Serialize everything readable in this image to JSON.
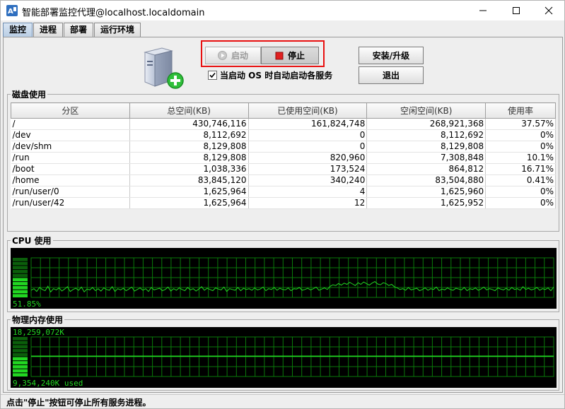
{
  "window": {
    "title": "智能部署监控代理@localhost.localdomain"
  },
  "tabs": [
    {
      "label": "监控",
      "active": true
    },
    {
      "label": "进程",
      "active": false
    },
    {
      "label": "部署",
      "active": false
    },
    {
      "label": "运行环境",
      "active": false
    }
  ],
  "controls": {
    "start_label": "启动",
    "start_enabled": false,
    "stop_label": "停止",
    "install_label": "安装/升级",
    "exit_label": "退出",
    "autostart_label": "当启动 OS 时自动启动各服务",
    "autostart_checked": true,
    "highlight_color": "#e81010"
  },
  "disk": {
    "title": "磁盘使用",
    "columns": [
      "分区",
      "总空间(KB)",
      "已使用空间(KB)",
      "空闲空间(KB)",
      "使用率"
    ],
    "rows": [
      [
        "/",
        "430,746,116",
        "161,824,748",
        "268,921,368",
        "37.57%"
      ],
      [
        "/dev",
        "8,112,692",
        "0",
        "8,112,692",
        "0%"
      ],
      [
        "/dev/shm",
        "8,129,808",
        "0",
        "8,129,808",
        "0%"
      ],
      [
        "/run",
        "8,129,808",
        "820,960",
        "7,308,848",
        "10.1%"
      ],
      [
        "/boot",
        "1,038,336",
        "173,524",
        "864,812",
        "16.71%"
      ],
      [
        "/home",
        "83,845,120",
        "340,240",
        "83,504,880",
        "0.41%"
      ],
      [
        "/run/user/0",
        "1,625,964",
        "4",
        "1,625,960",
        "0%"
      ],
      [
        "/run/user/42",
        "1,625,964",
        "12",
        "1,625,952",
        "0%"
      ]
    ]
  },
  "cpu": {
    "title": "CPU 使用",
    "value_label": "51.85%",
    "level": 0.5185,
    "color": "#22d622",
    "history": [
      0.18,
      0.22,
      0.15,
      0.25,
      0.2,
      0.17,
      0.28,
      0.14,
      0.22,
      0.19,
      0.24,
      0.16,
      0.21,
      0.27,
      0.15,
      0.2,
      0.23,
      0.18,
      0.26,
      0.14,
      0.21,
      0.19,
      0.25,
      0.17,
      0.22,
      0.16,
      0.24,
      0.2,
      0.18,
      0.27,
      0.15,
      0.22,
      0.19,
      0.23,
      0.17,
      0.21,
      0.26,
      0.16,
      0.2,
      0.24,
      0.18,
      0.22,
      0.15,
      0.25,
      0.19,
      0.21,
      0.23,
      0.17,
      0.2,
      0.26,
      0.16,
      0.22,
      0.18,
      0.24,
      0.2,
      0.17,
      0.25,
      0.19,
      0.22,
      0.16,
      0.21,
      0.27,
      0.18,
      0.23,
      0.2,
      0.17,
      0.24,
      0.21,
      0.19,
      0.26,
      0.15,
      0.22,
      0.2,
      0.18,
      0.25,
      0.17,
      0.23,
      0.2,
      0.22,
      0.18,
      0.24,
      0.19,
      0.21,
      0.26,
      0.17,
      0.22,
      0.2,
      0.25,
      0.18,
      0.23,
      0.2,
      0.19,
      0.24,
      0.17,
      0.22,
      0.21,
      0.25,
      0.18,
      0.2,
      0.23,
      0.19,
      0.22,
      0.26,
      0.18,
      0.21,
      0.24,
      0.2,
      0.28,
      0.32,
      0.3,
      0.35,
      0.31,
      0.36,
      0.33,
      0.38,
      0.34,
      0.3,
      0.37,
      0.33,
      0.39,
      0.35,
      0.31,
      0.36,
      0.4,
      0.34,
      0.32,
      0.37,
      0.35,
      0.3,
      0.33,
      0.27,
      0.24,
      0.2,
      0.22,
      0.18,
      0.25,
      0.19,
      0.21,
      0.23,
      0.17,
      0.2,
      0.24,
      0.18,
      0.22,
      0.2,
      0.26,
      0.17,
      0.21,
      0.19,
      0.24,
      0.2,
      0.18,
      0.23,
      0.21,
      0.19,
      0.25,
      0.17,
      0.22,
      0.2,
      0.24,
      0.18,
      0.21,
      0.26,
      0.19,
      0.22,
      0.2,
      0.17,
      0.24,
      0.21,
      0.19,
      0.23,
      0.18,
      0.25,
      0.2,
      0.22,
      0.18,
      0.27,
      0.2,
      0.23,
      0.19,
      0.21,
      0.25,
      0.18,
      0.22,
      0.2,
      0.24,
      0.17,
      0.26
    ]
  },
  "memory": {
    "title": "物理内存使用",
    "total_label": "18,259,072K",
    "used_label": "9,354,240K used",
    "level": 0.512,
    "color": "#22d622"
  },
  "status": {
    "text": "点击\"停止\"按钮可停止所有服务进程。"
  }
}
